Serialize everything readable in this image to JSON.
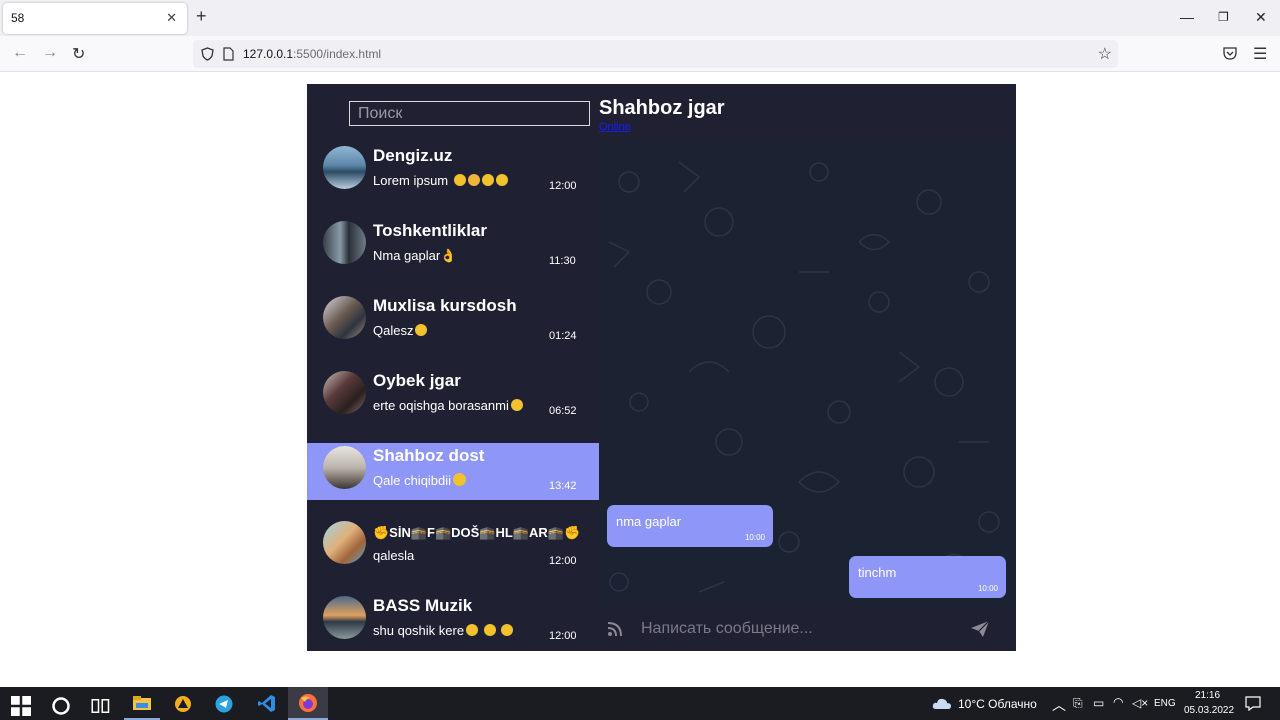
{
  "browser": {
    "tab_title": "58",
    "url_host": "127.0.0.1",
    "url_rest": ":5500/index.html"
  },
  "app": {
    "search_placeholder": "Поиск",
    "chats": [
      {
        "name": "Dengiz.uz",
        "message": "Lorem ipsum",
        "emoji_count": 4,
        "time": "12:00"
      },
      {
        "name": "Toshkentliklar",
        "message": "Nma gaplar👌",
        "emoji_count": 0,
        "time": "11:30"
      },
      {
        "name": "Muxlisa kursdosh",
        "message": "Qalesz",
        "emoji_count": 1,
        "time": "01:24"
      },
      {
        "name": "Oybek jgar",
        "message": "erte oqishga borasanmi",
        "emoji_count": 1,
        "time": "06:52"
      },
      {
        "name": "Shahboz dost",
        "message": "Qale chiqibdii",
        "emoji_count": 1,
        "time": "13:42",
        "active": true
      },
      {
        "name": "✊SİN🕋F🕋DOŠ🕋HL🕋AR🕋✊",
        "message": "qalesla",
        "emoji_count": 0,
        "time": "12:00"
      },
      {
        "name": "BASS Muzik",
        "message": "shu qoshik kere",
        "emoji_count": 3,
        "time": "12:00"
      }
    ],
    "chat": {
      "title": "Shahboz jgar",
      "status": "Online",
      "messages": [
        {
          "text": "nma gaplar",
          "time": "10:00",
          "side": "in"
        },
        {
          "text": "tinchm",
          "time": "10:00",
          "side": "out"
        }
      ],
      "input_placeholder": "Написать сообщение..."
    }
  },
  "taskbar": {
    "weather": "10°C  Облачно",
    "lang": "ENG",
    "time": "21:16",
    "date": "05.03.2022"
  },
  "colors": {
    "accent": "#8e96f7",
    "panel": "#1f2133",
    "chat_bg": "#1b2232"
  },
  "icons": [
    "back-arrow-icon",
    "forward-arrow-icon",
    "reload-icon",
    "shield-icon",
    "page-icon",
    "bookmark-star-icon",
    "pocket-icon",
    "menu-icon",
    "rss-icon",
    "send-icon",
    "windows-icon",
    "cortana-icon",
    "task-view-icon",
    "file-explorer-icon",
    "telegram-icon",
    "vscode-icon",
    "firefox-icon",
    "cloud-icon"
  ]
}
